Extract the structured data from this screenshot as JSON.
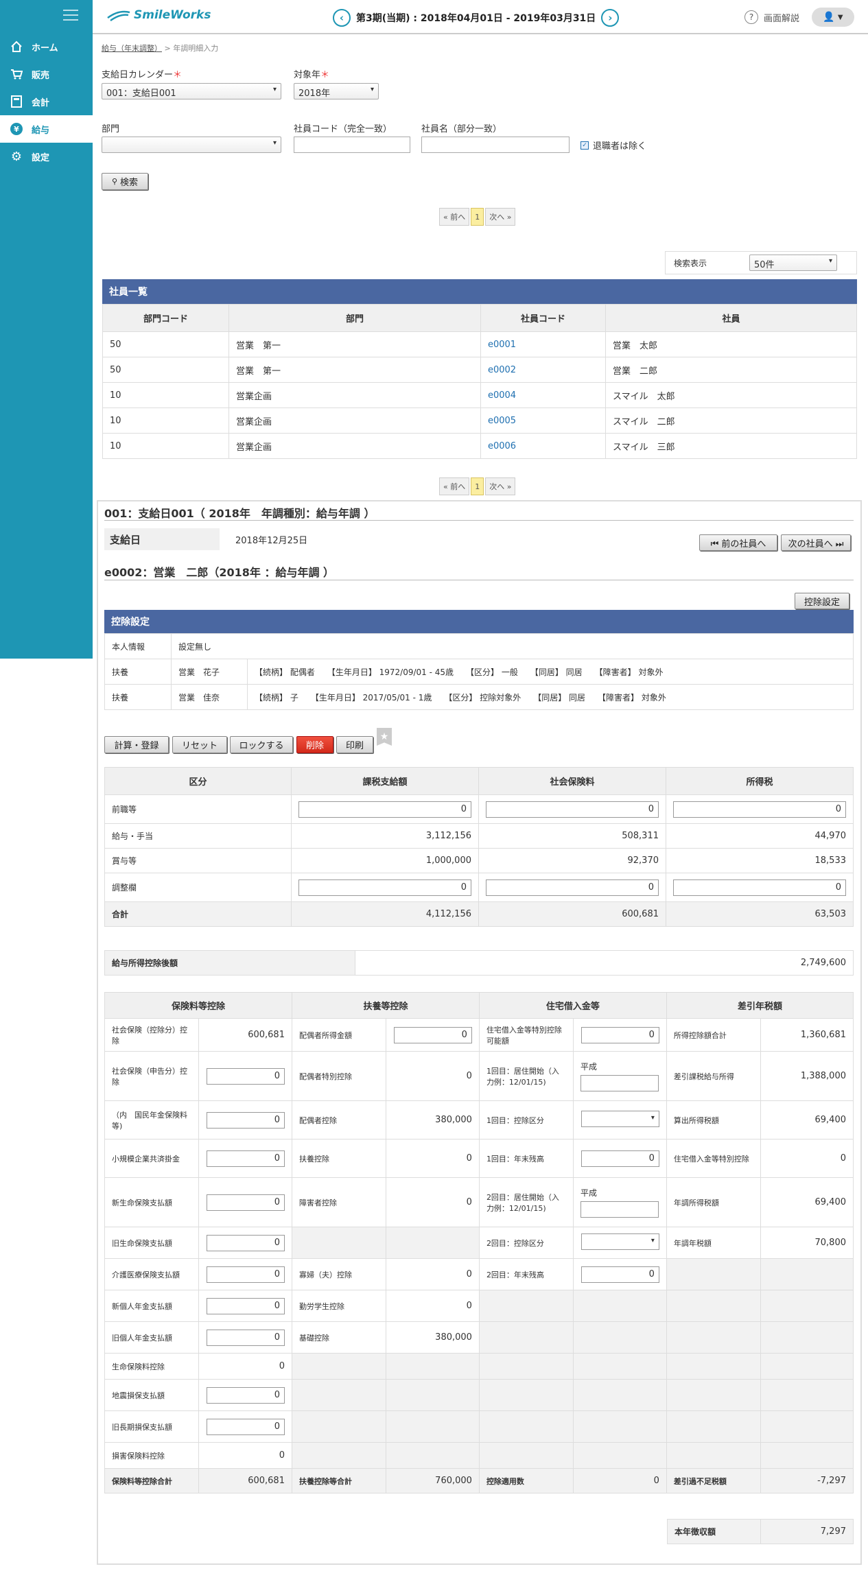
{
  "sidebar": {
    "items": [
      {
        "label": "ホーム"
      },
      {
        "label": "販売"
      },
      {
        "label": "会計"
      },
      {
        "label": "給与"
      },
      {
        "label": "設定"
      }
    ]
  },
  "header": {
    "logo": "SmileWorks",
    "period": "第3期(当期) : 2018年04月01日 - 2019年03月31日",
    "help": "画面解説"
  },
  "breadcrumb": {
    "parent": "給与（年末調整）",
    "sep": ">",
    "current": "年調明細入力"
  },
  "filters": {
    "calendar_label": "支給日カレンダー",
    "calendar_value": "001：支給日001",
    "year_label": "対象年",
    "year_value": "2018年",
    "dept_label": "部門",
    "dept_value": "",
    "code_label": "社員コード（完全一致）",
    "name_label": "社員名（部分一致）",
    "exclude_label": "退職者は除く",
    "search": "検索"
  },
  "pager": {
    "prev": "« 前へ",
    "page": "1",
    "next": "次へ »"
  },
  "display": {
    "label": "検索表示",
    "value": "50件"
  },
  "employee_list": {
    "title": "社員一覧",
    "headers": [
      "部門コード",
      "部門",
      "社員コード",
      "社員"
    ],
    "rows": [
      [
        "50",
        "営業　第一",
        "e0001",
        "営業　太郎"
      ],
      [
        "50",
        "営業　第一",
        "e0002",
        "営業　二郎"
      ],
      [
        "10",
        "営業企画",
        "e0004",
        "スマイル　太郎"
      ],
      [
        "10",
        "営業企画",
        "e0005",
        "スマイル　二郎"
      ],
      [
        "10",
        "営業企画",
        "e0006",
        "スマイル　三郎"
      ]
    ]
  },
  "detail": {
    "heading": "001：支給日001（ 2018年　年調種別：給与年調 ）",
    "payday_label": "支給日",
    "payday": "2018年12月25日",
    "prev_emp": "⏮ 前の社員へ",
    "next_emp": "次の社員へ ⏭",
    "emp_heading": "e0002：営業　二郎（2018年 ：給与年調 ）",
    "deduction_btn": "控除設定",
    "deduction_title": "控除設定",
    "deduction_rows": [
      {
        "type": "本人情報",
        "name": "設定無し",
        "detail": ""
      },
      {
        "type": "扶養",
        "name": "営業　花子",
        "detail": "【続柄】 配偶者　　【生年月日】 1972/09/01 - 45歳　　【区分】 一般　　【同居】 同居　　【障害者】 対象外"
      },
      {
        "type": "扶養",
        "name": "営業　佳奈",
        "detail": "【続柄】 子　　【生年月日】 2017/05/01 - 1歳　　【区分】 控除対象外　　【同居】 同居　　【障害者】 対象外"
      }
    ],
    "actions": {
      "calc": "計算・登録",
      "reset": "リセット",
      "lock": "ロックする",
      "delete": "削除",
      "print": "印刷"
    }
  },
  "summary": {
    "headers": [
      "区分",
      "課税支給額",
      "社会保険料",
      "所得税"
    ],
    "rows": [
      {
        "label": "前職等",
        "input": true,
        "v": [
          "0",
          "0",
          "0"
        ]
      },
      {
        "label": "給与・手当",
        "input": false,
        "v": [
          "3,112,156",
          "508,311",
          "44,970"
        ]
      },
      {
        "label": "賞与等",
        "input": false,
        "v": [
          "1,000,000",
          "92,370",
          "18,533"
        ]
      },
      {
        "label": "調整欄",
        "input": true,
        "v": [
          "0",
          "0",
          "0"
        ]
      },
      {
        "label": "合計",
        "input": false,
        "total": true,
        "v": [
          "4,112,156",
          "600,681",
          "63,503"
        ]
      }
    ]
  },
  "after_deduction": {
    "label": "給与所得控除後額",
    "value": "2,749,600"
  },
  "calc": {
    "headers": [
      "保険料等控除",
      "扶養等控除",
      "住宅借入金等",
      "差引年税額"
    ],
    "rows": [
      [
        [
          "社会保険（控除分）控除",
          "600,681",
          ""
        ],
        [
          "配偶者所得金額",
          "0",
          "inp"
        ],
        [
          "住宅借入金等特別控除可能額",
          "0",
          "inp"
        ],
        [
          "所得控除額合計",
          "1,360,681",
          ""
        ]
      ],
      [
        [
          "社会保険（申告分）控除",
          "0",
          "inp"
        ],
        [
          "配偶者特別控除",
          "0",
          ""
        ],
        [
          "1回目：居住開始（入力例：12/01/15)",
          "平成",
          "era"
        ],
        [
          "差引課税給与所得",
          "1,388,000",
          ""
        ]
      ],
      [
        [
          "（内　国民年金保険料等)",
          "0",
          "inp"
        ],
        [
          "配偶者控除",
          "380,000",
          ""
        ],
        [
          "1回目：控除区分",
          "",
          "sel"
        ],
        [
          "算出所得税額",
          "69,400",
          ""
        ]
      ],
      [
        [
          "小規模企業共済掛金",
          "0",
          "inp"
        ],
        [
          "扶養控除",
          "0",
          ""
        ],
        [
          "1回目：年末残高",
          "0",
          "inp"
        ],
        [
          "住宅借入金等特別控除",
          "0",
          ""
        ]
      ],
      [
        [
          "新生命保険支払額",
          "0",
          "inp"
        ],
        [
          "障害者控除",
          "0",
          ""
        ],
        [
          "2回目：居住開始（入力例：12/01/15)",
          "平成",
          "era"
        ],
        [
          "年調所得税額",
          "69,400",
          ""
        ]
      ],
      [
        [
          "旧生命保険支払額",
          "0",
          "inp"
        ],
        [
          "",
          "",
          ""
        ],
        [
          "2回目：控除区分",
          "",
          "sel"
        ],
        [
          "年調年税額",
          "70,800",
          ""
        ]
      ],
      [
        [
          "介護医療保険支払額",
          "0",
          "inp"
        ],
        [
          "寡婦（夫）控除",
          "0",
          ""
        ],
        [
          "2回目：年末残高",
          "0",
          "inp"
        ],
        [
          "",
          "",
          ""
        ]
      ],
      [
        [
          "新個人年金支払額",
          "0",
          "inp"
        ],
        [
          "勤労学生控除",
          "0",
          ""
        ],
        [
          "",
          "",
          ""
        ],
        [
          "",
          "",
          ""
        ]
      ],
      [
        [
          "旧個人年金支払額",
          "0",
          "inp"
        ],
        [
          "基礎控除",
          "380,000",
          ""
        ],
        [
          "",
          "",
          ""
        ],
        [
          "",
          "",
          ""
        ]
      ],
      [
        [
          "生命保険料控除",
          "0",
          ""
        ],
        [
          "",
          "",
          ""
        ],
        [
          "",
          "",
          ""
        ],
        [
          "",
          "",
          ""
        ]
      ],
      [
        [
          "地震損保支払額",
          "0",
          "inp"
        ],
        [
          "",
          "",
          ""
        ],
        [
          "",
          "",
          ""
        ],
        [
          "",
          "",
          ""
        ]
      ],
      [
        [
          "旧長期損保支払額",
          "0",
          "inp"
        ],
        [
          "",
          "",
          ""
        ],
        [
          "",
          "",
          ""
        ],
        [
          "",
          "",
          ""
        ]
      ],
      [
        [
          "損害保険料控除",
          "0",
          ""
        ],
        [
          "",
          "",
          ""
        ],
        [
          "",
          "",
          ""
        ],
        [
          "",
          "",
          ""
        ]
      ]
    ],
    "totals": [
      [
        "保険料等控除合計",
        "600,681"
      ],
      [
        "扶養控除等合計",
        "760,000"
      ],
      [
        "控除適用数",
        "0"
      ],
      [
        "差引過不足税額",
        "-7,297"
      ]
    ],
    "final": {
      "label": "本年徴収額",
      "value": "7,297"
    }
  }
}
